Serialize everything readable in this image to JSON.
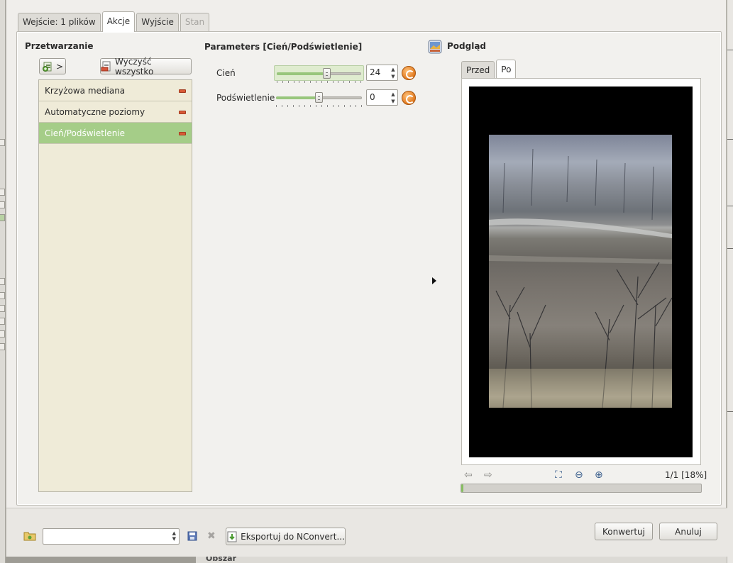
{
  "tabs": [
    {
      "label": "Wejście: 1 plików",
      "state": "normal"
    },
    {
      "label": "Akcje",
      "state": "active"
    },
    {
      "label": "Wyjście",
      "state": "normal"
    },
    {
      "label": "Stan",
      "state": "disabled"
    }
  ],
  "processing": {
    "title": "Przetwarzanie",
    "add_button_label": ">",
    "clear_button_label": "Wyczyść wszystko",
    "actions": [
      {
        "label": "Krzyżowa mediana",
        "selected": false
      },
      {
        "label": "Automatyczne poziomy",
        "selected": false
      },
      {
        "label": "Cień/Podświetlenie",
        "selected": true
      }
    ]
  },
  "parameters": {
    "title": "Parameters [Cień/Podświetlenie]",
    "items": [
      {
        "label": "Cień",
        "value": "24",
        "level": 0.6
      },
      {
        "label": "Podświetlenie",
        "value": "0",
        "level": 0.5
      }
    ]
  },
  "preview": {
    "title": "Podgląd",
    "tabs": [
      {
        "label": "Przed",
        "active": false
      },
      {
        "label": "Po",
        "active": true
      }
    ],
    "zoom_info": "1/1 [18%]",
    "progress": 0.01
  },
  "bottom": {
    "export_label": "Eksportuj do NConvert...",
    "convert_label": "Konwertuj",
    "cancel_label": "Anuluj",
    "combo_value": ""
  },
  "background": {
    "section_label": "Obszar"
  },
  "colors": {
    "selected_item": "#a5cd88",
    "list_bg": "#efebd8",
    "remove_icon": "#d85a37",
    "slider_fill": "#98c67c",
    "reset_icon": "#e1781d",
    "progress_fill": "#87be62"
  }
}
